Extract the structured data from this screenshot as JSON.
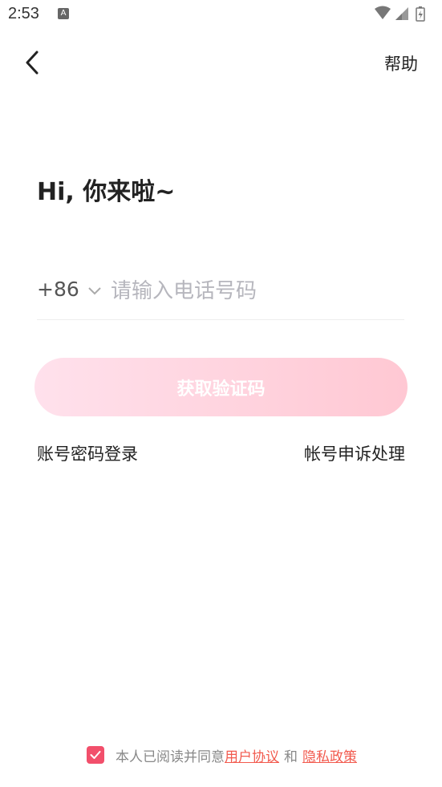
{
  "status_bar": {
    "time": "2:53",
    "notification_icon": "a-icon",
    "icons": [
      "wifi-icon",
      "signal-icon",
      "battery-icon"
    ]
  },
  "header": {
    "back_icon": "chevron-left-icon",
    "help_label": "帮助"
  },
  "main": {
    "greeting": "Hi, 你来啦~",
    "country_code": "+86",
    "phone_placeholder": "请输入电话号码",
    "phone_value": "",
    "otp_button_label": "获取验证码",
    "password_login_label": "账号密码登录",
    "account_appeal_label": "帐号申诉处理"
  },
  "agreement": {
    "checked": true,
    "prefix": "本人已阅读并同意",
    "user_agreement": "用户协议",
    "and": "和",
    "privacy_policy": "隐私政策"
  },
  "colors": {
    "accent": "#f24f6b",
    "link": "#f25a4e",
    "button_gradient_start": "#ffe1ec",
    "button_gradient_end": "#ffc8d3"
  }
}
